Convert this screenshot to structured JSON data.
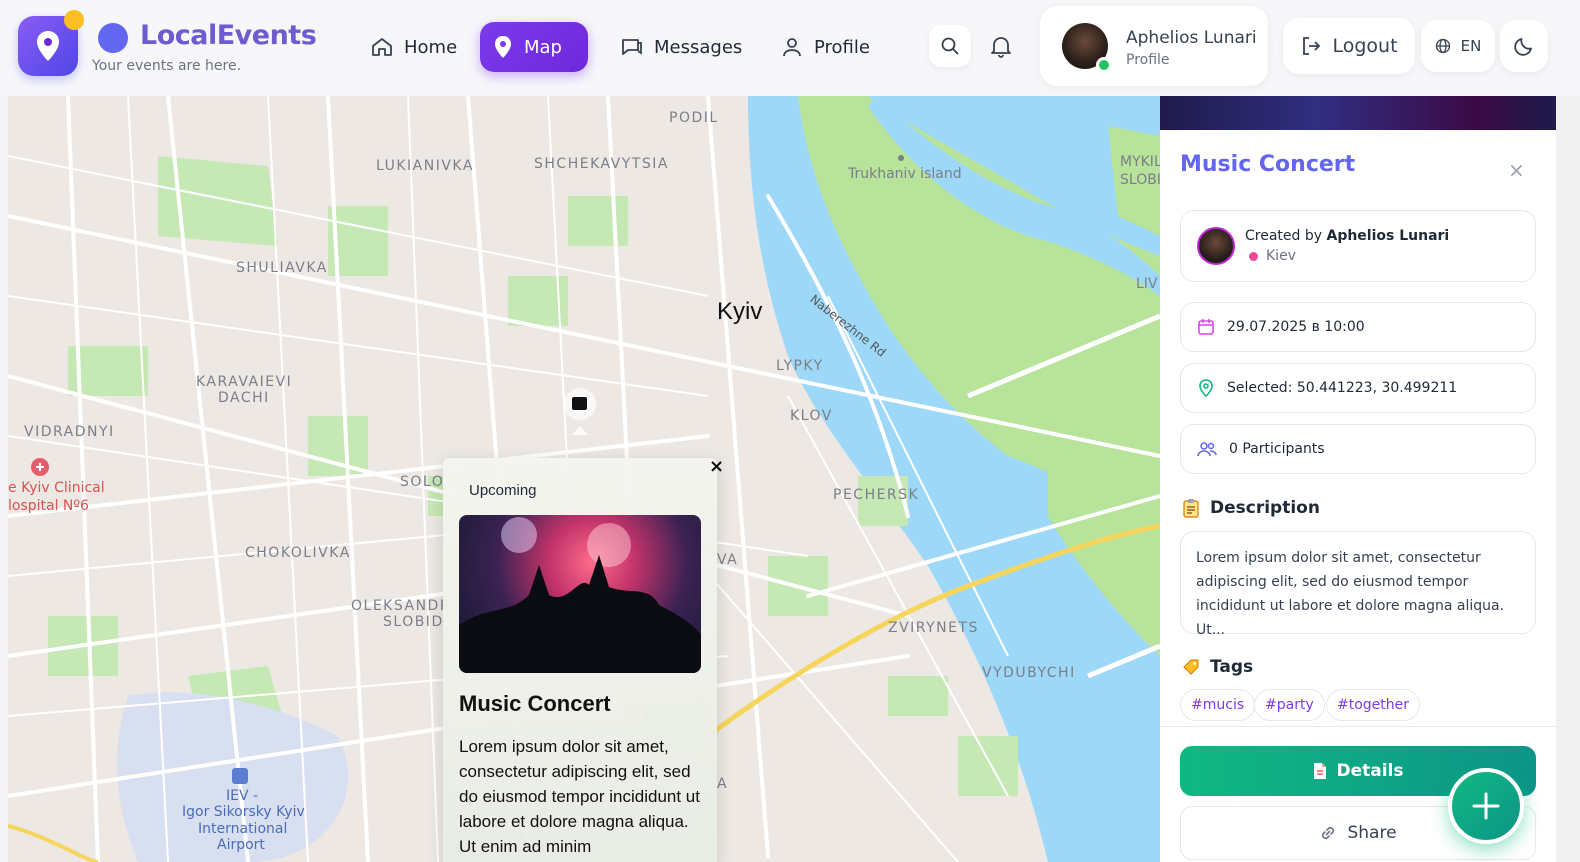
{
  "header": {
    "brand_title": "LocalEvents",
    "brand_subtitle": "Your events are here.",
    "nav": [
      {
        "label": "Home",
        "icon": "home-icon"
      },
      {
        "label": "Map",
        "icon": "map-pin-icon",
        "active": true
      },
      {
        "label": "Messages",
        "icon": "message-icon"
      },
      {
        "label": "Profile",
        "icon": "user-icon"
      }
    ],
    "user": {
      "name": "Aphelios Lunari",
      "role": "Profile"
    },
    "logout_label": "Logout",
    "language": "EN"
  },
  "map": {
    "labels": [
      {
        "text": "PODIL"
      },
      {
        "text": "LUKIANIVKA"
      },
      {
        "text": "SHCHEKAVYTSIA"
      },
      {
        "text": "Trukhaniv island"
      },
      {
        "text": "MYKIL"
      },
      {
        "text": "SLOBI"
      },
      {
        "text": "SHULIAVKA"
      },
      {
        "text": "LIV"
      },
      {
        "text": "Kyiv"
      },
      {
        "text": "Naberezhne Rd"
      },
      {
        "text": "LYPKY"
      },
      {
        "text": "KARAVAIEVI"
      },
      {
        "text": "DACHI"
      },
      {
        "text": "KLOV"
      },
      {
        "text": "VIDRADNYI"
      },
      {
        "text": "e Kyiv Clinical"
      },
      {
        "text": "lospital Nº6"
      },
      {
        "text": "SOLO"
      },
      {
        "text": "PECHERSK"
      },
      {
        "text": "CHOKOLIVKA"
      },
      {
        "text": "VA"
      },
      {
        "text": "OLEKSANDR"
      },
      {
        "text": "SLOBID"
      },
      {
        "text": "ZVIRYNETS"
      },
      {
        "text": "VYDUBYCHI"
      },
      {
        "text": "IEV -"
      },
      {
        "text": "Igor Sikorsky Kyiv"
      },
      {
        "text": "International"
      },
      {
        "text": "Airport"
      },
      {
        "text": "A"
      }
    ],
    "popup": {
      "status": "Upcoming",
      "title": "Music Concert",
      "description": "Lorem ipsum dolor sit amet, consectetur adipiscing elit, sed do eiusmod tempor incididunt ut labore et dolore magna aliqua. Ut enim ad minim"
    }
  },
  "panel": {
    "title": "Music Concert",
    "created_by_prefix": "Created by",
    "creator": "Aphelios Lunari",
    "city": "Kiev",
    "datetime": "29.07.2025 в 10:00",
    "selected_location": "Selected: 50.441223, 30.499211",
    "participants": "0 Participants",
    "description_title": "Description",
    "description": "Lorem ipsum dolor sit amet, consectetur adipiscing elit, sed do eiusmod tempor incididunt ut labore et dolore magna aliqua. Ut...",
    "tags_title": "Tags",
    "tags": [
      "#mucis",
      "#party",
      "#together"
    ],
    "details_label": "Details",
    "share_label": "Share"
  }
}
